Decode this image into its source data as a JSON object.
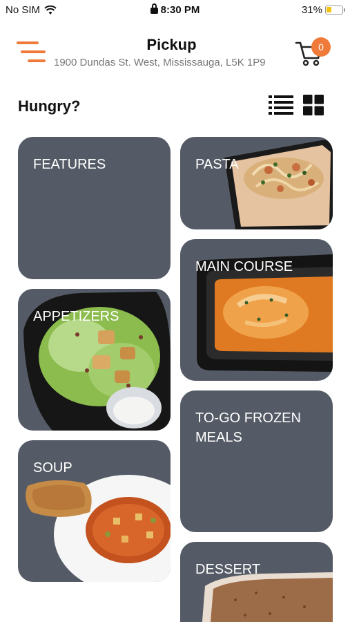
{
  "status_bar": {
    "carrier": "No SIM",
    "time": "8:30 PM",
    "battery": "31%",
    "battery_level": 0.31
  },
  "header": {
    "title": "Pickup",
    "address": "1900 Dundas St. West, Mississauga, L5K 1P9",
    "cart_count": "0",
    "icons": {
      "menu": "menu-icon",
      "cart": "cart-icon"
    }
  },
  "section": {
    "title": "Hungry?",
    "icons": {
      "list": "list-view-icon",
      "grid": "grid-view-icon"
    }
  },
  "categories": [
    {
      "label": "FEATURES"
    },
    {
      "label": "PASTA"
    },
    {
      "label": "MAIN COURSE"
    },
    {
      "label": "APPETIZERS"
    },
    {
      "label": "TO-GO FROZEN MEALS"
    },
    {
      "label": "SOUP"
    },
    {
      "label": "DESSERT"
    }
  ],
  "colors": {
    "accent": "#ef7a3c",
    "tile": "#555b66",
    "battery": "#f2c40f"
  }
}
